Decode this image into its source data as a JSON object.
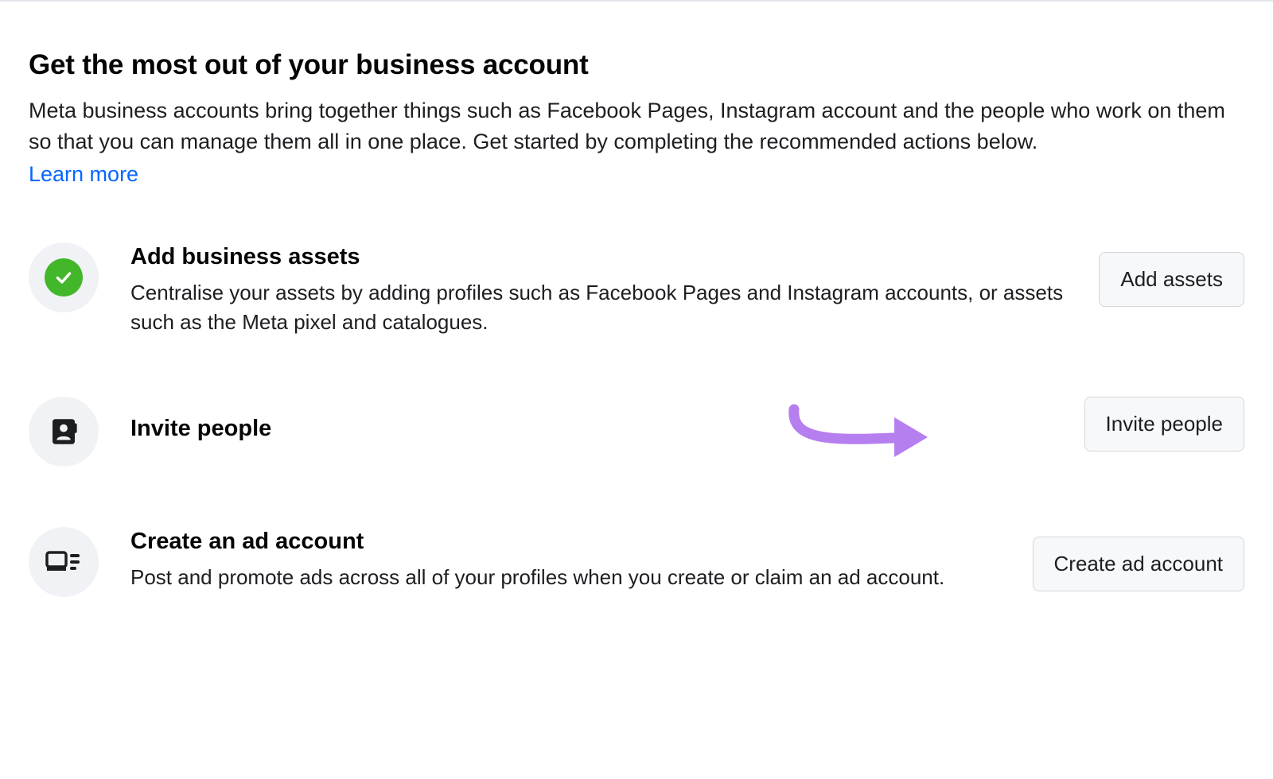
{
  "header": {
    "title": "Get the most out of your business account",
    "description": "Meta business accounts bring together things such as Facebook Pages, Instagram account and the people who work on them so that you can manage them all in one place. Get started by completing the recommended actions below.",
    "learn_more": "Learn more"
  },
  "actions": [
    {
      "icon": "check-complete",
      "title": "Add business assets",
      "description": "Centralise your assets by adding profiles such as Facebook Pages and Instagram accounts, or assets such as the Meta pixel and catalogues.",
      "button_label": "Add assets"
    },
    {
      "icon": "person-card",
      "title": "Invite people",
      "description": "",
      "button_label": "Invite people",
      "highlighted": true
    },
    {
      "icon": "ad-account",
      "title": "Create an ad account",
      "description": "Post and promote ads across all of your profiles when you create or claim an ad account.",
      "button_label": "Create ad account"
    }
  ],
  "colors": {
    "link": "#0866ff",
    "success": "#42b72a",
    "arrow": "#b57fef"
  }
}
